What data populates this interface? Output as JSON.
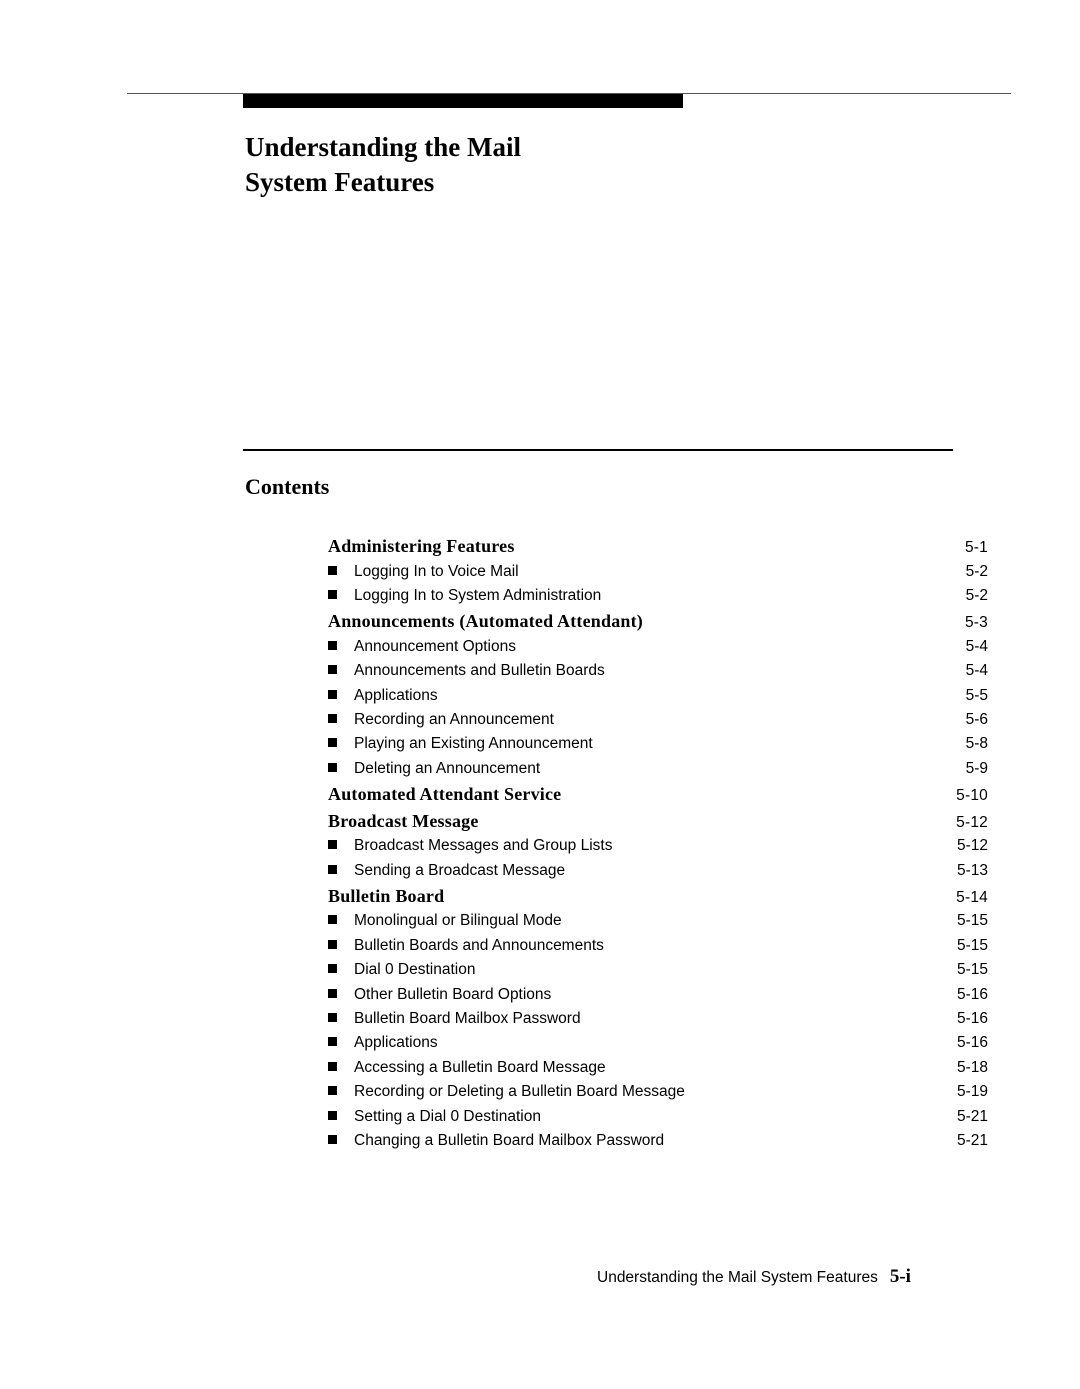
{
  "chapter": {
    "title_line1": "Understanding the Mail",
    "title_line2": "System Features"
  },
  "contents": {
    "heading": "Contents",
    "entries": [
      {
        "type": "section",
        "label": "Administering Features",
        "page": "5-1"
      },
      {
        "type": "sub",
        "label": "Logging In to Voice Mail",
        "page": "5-2"
      },
      {
        "type": "sub",
        "label": "Logging In to System Administration",
        "page": "5-2"
      },
      {
        "type": "section",
        "label": "Announcements (Automated Attendant)",
        "page": "5-3"
      },
      {
        "type": "sub",
        "label": "Announcement Options",
        "page": "5-4"
      },
      {
        "type": "sub",
        "label": "Announcements and Bulletin Boards",
        "page": "5-4"
      },
      {
        "type": "sub",
        "label": "Applications",
        "page": "5-5"
      },
      {
        "type": "sub",
        "label": "Recording an Announcement",
        "page": "5-6"
      },
      {
        "type": "sub",
        "label": "Playing an Existing Announcement",
        "page": "5-8"
      },
      {
        "type": "sub",
        "label": "Deleting an Announcement",
        "page": "5-9"
      },
      {
        "type": "section",
        "label": "Automated Attendant Service",
        "page": "5-10"
      },
      {
        "type": "section",
        "label": "Broadcast Message",
        "page": "5-12"
      },
      {
        "type": "sub",
        "label": "Broadcast Messages and Group Lists",
        "page": "5-12"
      },
      {
        "type": "sub",
        "label": "Sending a Broadcast Message",
        "page": "5-13"
      },
      {
        "type": "section",
        "label": "Bulletin Board",
        "page": "5-14"
      },
      {
        "type": "sub",
        "label": "Monolingual or Bilingual Mode",
        "page": "5-15"
      },
      {
        "type": "sub",
        "label": "Bulletin Boards and Announcements",
        "page": "5-15"
      },
      {
        "type": "sub",
        "label": "Dial 0 Destination",
        "page": "5-15"
      },
      {
        "type": "sub",
        "label": "Other Bulletin Board Options",
        "page": "5-16"
      },
      {
        "type": "sub",
        "label": "Bulletin Board Mailbox Password",
        "page": "5-16"
      },
      {
        "type": "sub",
        "label": "Applications",
        "page": "5-16"
      },
      {
        "type": "sub",
        "label": "Accessing a Bulletin Board Message",
        "page": "5-18"
      },
      {
        "type": "sub",
        "label": "Recording or Deleting a Bulletin Board Message",
        "page": "5-19"
      },
      {
        "type": "sub",
        "label": "Setting a Dial 0 Destination",
        "page": "5-21"
      },
      {
        "type": "sub",
        "label": "Changing a Bulletin Board Mailbox Password",
        "page": "5-21"
      }
    ]
  },
  "footer": {
    "text": "Understanding the Mail System Features",
    "page_number": "5-i"
  }
}
